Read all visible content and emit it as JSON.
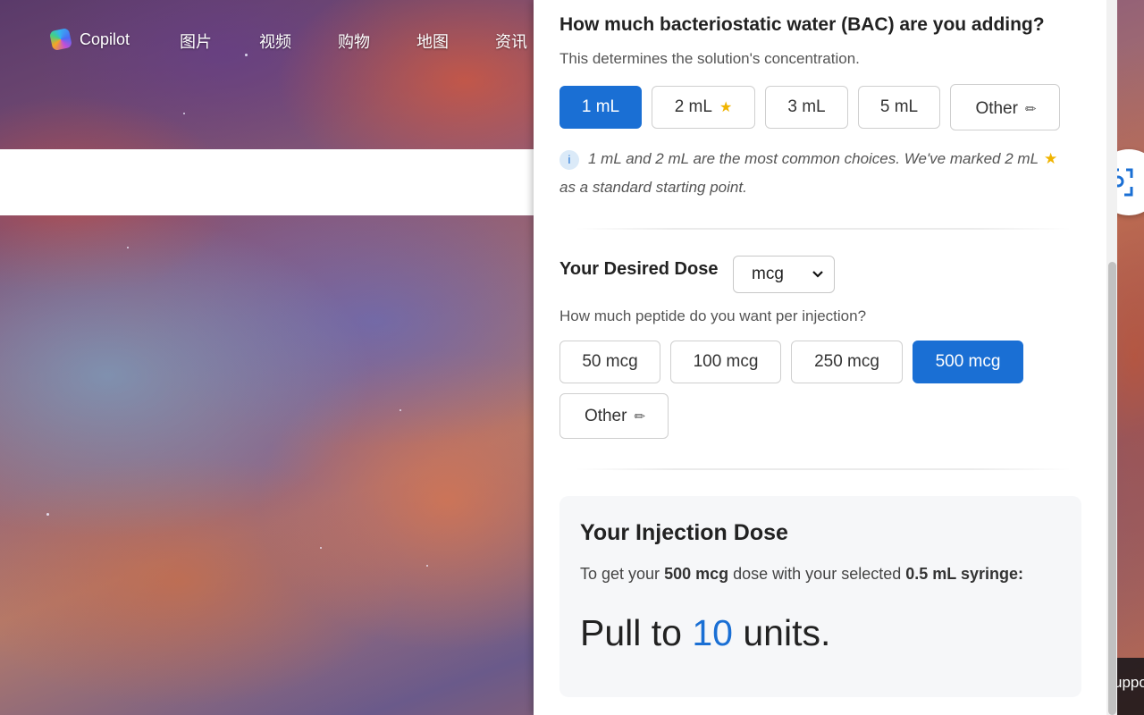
{
  "nav": {
    "copilot": "Copilot",
    "links": [
      "图片",
      "视频",
      "购物",
      "地图",
      "资讯"
    ]
  },
  "corner_text": "uppor",
  "bac": {
    "title": "How much bacteriostatic water (BAC) are you adding?",
    "subtitle": "This determines the solution's concentration.",
    "options": [
      "1 mL",
      "2 mL",
      "3 mL",
      "5 mL",
      "Other"
    ],
    "selected": "1 mL",
    "recommended": "2 mL",
    "hint_part1": "1 mL and 2 mL are the most common choices. We've marked 2 mL",
    "hint_part2": "as a standard starting point."
  },
  "dose": {
    "title": "Your Desired Dose",
    "unit": "mcg",
    "subtitle": "How much peptide do you want per injection?",
    "options": [
      "50 mcg",
      "100 mcg",
      "250 mcg",
      "500 mcg",
      "Other"
    ],
    "selected": "500 mcg"
  },
  "result": {
    "title": "Your Injection Dose",
    "desc_pre": "To get your",
    "desc_dose": "500 mcg",
    "desc_mid": "dose with your selected",
    "desc_syringe": "0.5 mL syringe:",
    "pull_pre": "Pull to",
    "units_value": "10",
    "pull_post": "units."
  },
  "colors": {
    "accent": "#1a6fd4",
    "star": "#f0b400"
  },
  "icons": {
    "info": "i",
    "star": "★",
    "pencil": "✏"
  }
}
